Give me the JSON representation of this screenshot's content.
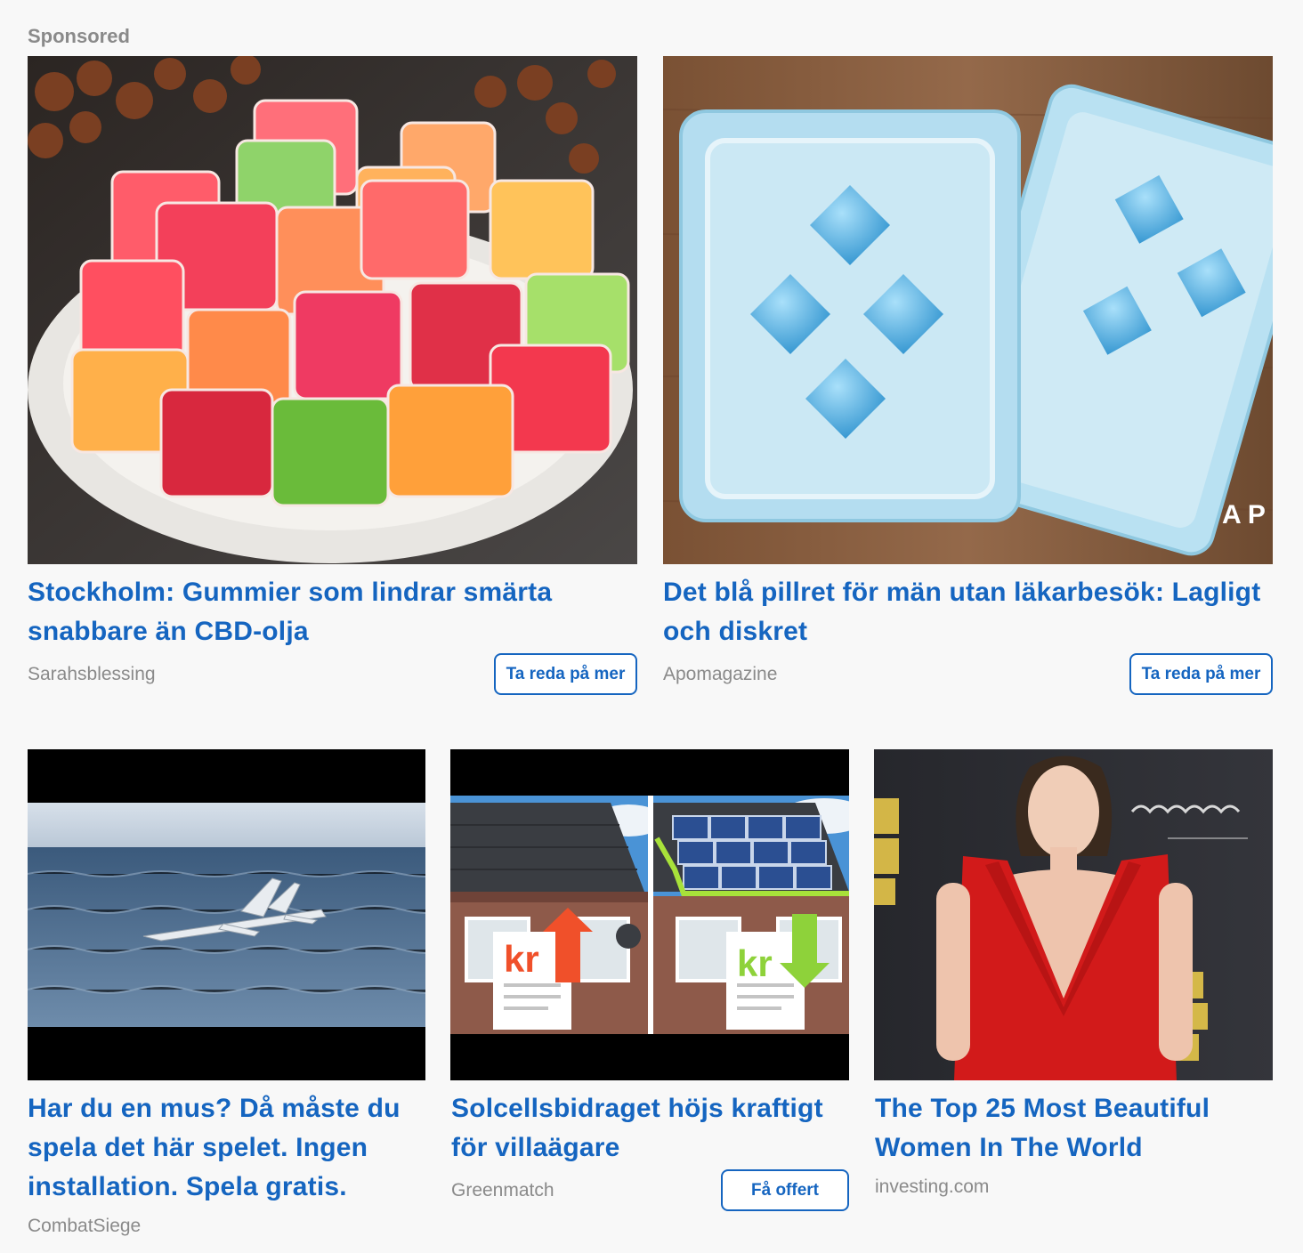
{
  "header": {
    "label": "Sponsored"
  },
  "ads": [
    {
      "title": "Stockholm: Gummier som lindrar smärta snabbare än CBD-olja",
      "source": "Sarahsblessing",
      "cta": "Ta reda på mer",
      "image": "gummies-plate-image"
    },
    {
      "title": "Det blå pillret för män utan läkarbesök: Lagligt och diskret",
      "source": "Apomagazine",
      "cta": "Ta reda på mer",
      "image": "blue-pills-blister-image",
      "watermark": "A P"
    },
    {
      "title": "Har du en mus? Då måste du spela det här spelet. Ingen installation. Spela gratis.",
      "source": "CombatSiege",
      "image": "fighter-jet-ocean-image"
    },
    {
      "title": "Solcellsbidraget höjs kraftigt för villaägare",
      "source": "Greenmatch",
      "cta": "Få offert",
      "image": "solar-panels-house-image",
      "badge_before": "kr",
      "badge_after": "kr"
    },
    {
      "title": "The Top 25 Most Beautiful Women In The World",
      "source": "investing.com",
      "image": "woman-red-dress-image"
    }
  ]
}
